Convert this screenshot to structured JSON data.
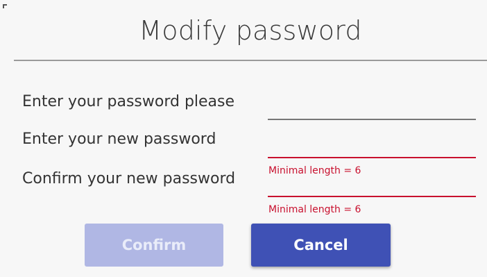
{
  "dialog": {
    "title": "Modify password"
  },
  "form": {
    "current_password": {
      "label": "Enter your password please",
      "value": "",
      "error": ""
    },
    "new_password": {
      "label": "Enter your new password",
      "value": "",
      "error": "Minimal length = 6"
    },
    "confirm_password": {
      "label": "Confirm your new password",
      "value": "",
      "error": "Minimal length = 6"
    }
  },
  "buttons": {
    "confirm_label": "Confirm",
    "confirm_disabled": true,
    "cancel_label": "Cancel"
  },
  "colors": {
    "primary": "#3f51b5",
    "primary_disabled": "#b0b7e4",
    "error": "#c8102e"
  }
}
